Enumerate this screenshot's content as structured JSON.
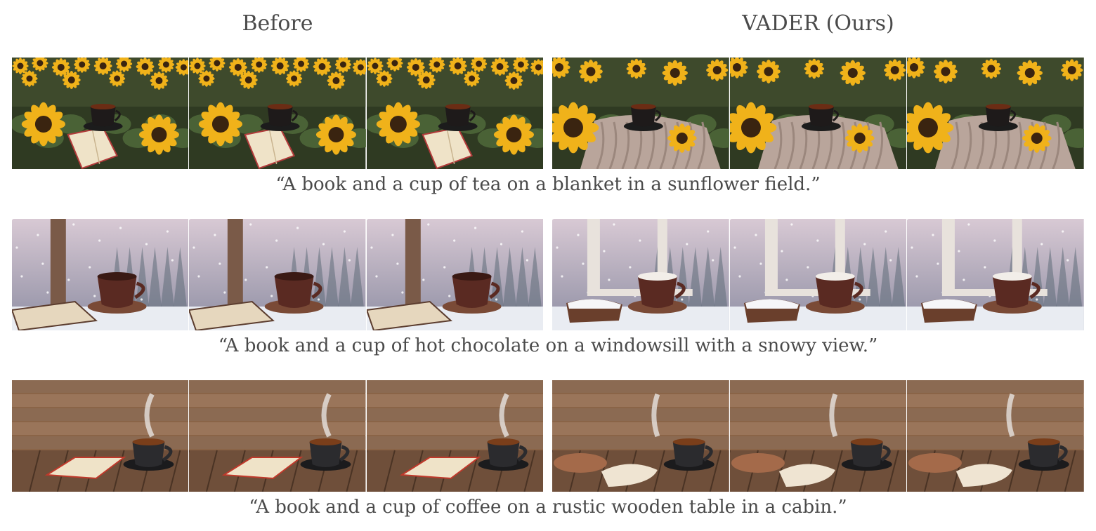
{
  "figure": {
    "column_headers": {
      "before": "Before",
      "after": "VADER (Ours)"
    },
    "rows": [
      {
        "caption": "“A book and a cup of tea on a blanket in a sunflower field.”",
        "scene": "sunflower-field"
      },
      {
        "caption": "“A book and a cup of hot chocolate on a windowsill with a snowy view.”",
        "scene": "snowy-window"
      },
      {
        "caption": "“A book and a cup of coffee on a rustic wooden table in a cabin.”",
        "scene": "wooden-cabin"
      }
    ]
  },
  "colors": {
    "sunflower_petal": "#f0b21a",
    "sunflower_center": "#3a2410",
    "snow_sky": "#c9c2cf",
    "wood": "#8a6447",
    "cup_brown": "#5a2a22",
    "cup_dark": "#2b2b2e"
  }
}
